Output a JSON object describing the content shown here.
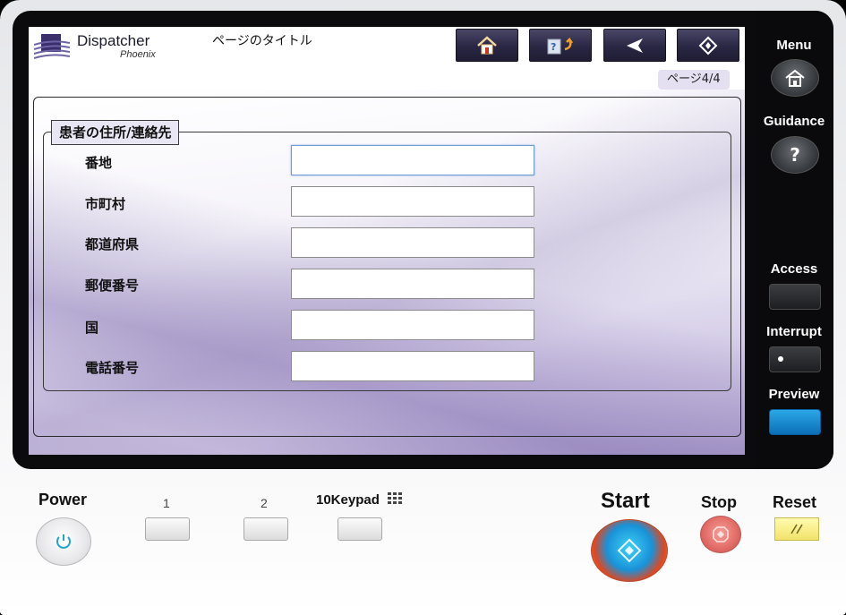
{
  "header": {
    "logo_name": "Dispatcher",
    "logo_sub": "Phoenix",
    "page_title": "ページのタイトル",
    "page_indicator": "ページ4/4"
  },
  "toolbar": {
    "buttons": [
      {
        "name": "home",
        "icon": "home-icon"
      },
      {
        "name": "help",
        "icon": "help-return-icon"
      },
      {
        "name": "back",
        "icon": "back-arrow-icon"
      },
      {
        "name": "start",
        "icon": "start-diamond-icon"
      }
    ]
  },
  "form": {
    "section_title": "患者の住所/連絡先",
    "fields": [
      {
        "label": "番地",
        "value": "",
        "focused": true
      },
      {
        "label": "市町村",
        "value": ""
      },
      {
        "label": "都道府県",
        "value": ""
      },
      {
        "label": "郵便番号",
        "value": ""
      },
      {
        "label": "国",
        "value": ""
      },
      {
        "label": "電話番号",
        "value": ""
      }
    ]
  },
  "side_panel": {
    "menu": "Menu",
    "guidance": "Guidance",
    "guidance_icon": "?",
    "access": "Access",
    "interrupt": "Interrupt",
    "preview": "Preview"
  },
  "hardware": {
    "power": "Power",
    "key1": "1",
    "key2": "2",
    "keypad": "10Keypad",
    "start": "Start",
    "stop": "Stop",
    "reset": "Reset"
  },
  "colors": {
    "toolbar_button": "#2a2744",
    "page_badge": "#e4e0f1",
    "preview_button": "#1a8fd6",
    "start_inner": "#1992d8",
    "stop_button": "#e26a64",
    "reset_button": "#f2e36a"
  }
}
